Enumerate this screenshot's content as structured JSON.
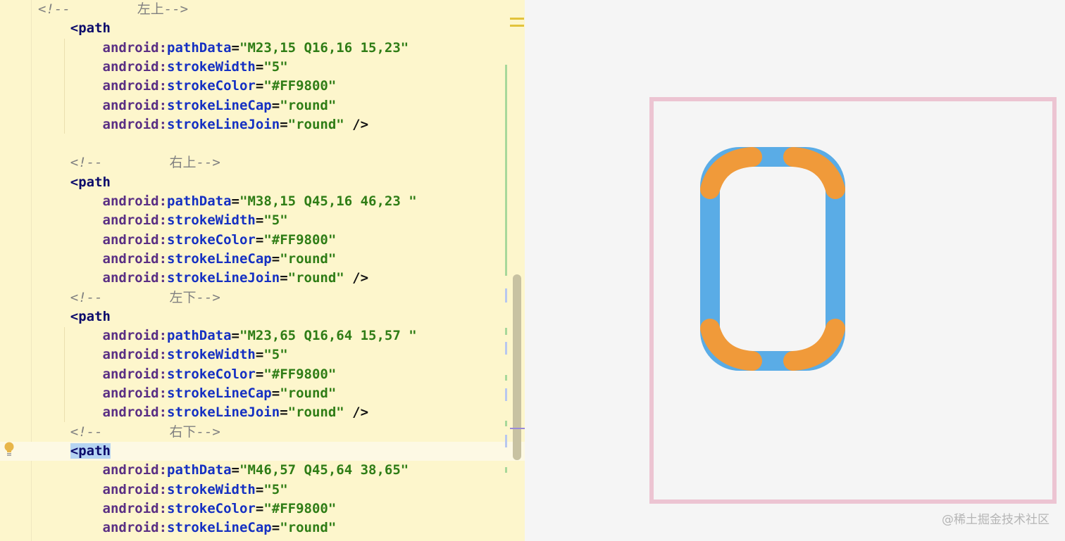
{
  "editor": {
    "lines": [
      {
        "kind": "comment",
        "indent": "",
        "open": "<!--",
        "label": "左上",
        "close": "-->"
      },
      {
        "kind": "tag",
        "indent": "    ",
        "text": "<path"
      },
      {
        "kind": "attr",
        "indent": "        ",
        "ns": "android:",
        "name": "pathData",
        "value": "\"M23,15 Q16,16 15,23\"",
        "tail": ""
      },
      {
        "kind": "attr",
        "indent": "        ",
        "ns": "android:",
        "name": "strokeWidth",
        "value": "\"5\"",
        "tail": ""
      },
      {
        "kind": "attr",
        "indent": "        ",
        "ns": "android:",
        "name": "strokeColor",
        "value": "\"#FF9800\"",
        "tail": ""
      },
      {
        "kind": "attr",
        "indent": "        ",
        "ns": "android:",
        "name": "strokeLineCap",
        "value": "\"round\"",
        "tail": ""
      },
      {
        "kind": "attr",
        "indent": "        ",
        "ns": "android:",
        "name": "strokeLineJoin",
        "value": "\"round\"",
        "tail": " />"
      },
      {
        "kind": "blank"
      },
      {
        "kind": "comment",
        "indent": "    ",
        "open": "<!--",
        "label": "右上",
        "close": "-->"
      },
      {
        "kind": "tag",
        "indent": "    ",
        "text": "<path"
      },
      {
        "kind": "attr",
        "indent": "        ",
        "ns": "android:",
        "name": "pathData",
        "value": "\"M38,15 Q45,16 46,23 \"",
        "tail": ""
      },
      {
        "kind": "attr",
        "indent": "        ",
        "ns": "android:",
        "name": "strokeWidth",
        "value": "\"5\"",
        "tail": ""
      },
      {
        "kind": "attr",
        "indent": "        ",
        "ns": "android:",
        "name": "strokeColor",
        "value": "\"#FF9800\"",
        "tail": ""
      },
      {
        "kind": "attr",
        "indent": "        ",
        "ns": "android:",
        "name": "strokeLineCap",
        "value": "\"round\"",
        "tail": ""
      },
      {
        "kind": "attr",
        "indent": "        ",
        "ns": "android:",
        "name": "strokeLineJoin",
        "value": "\"round\"",
        "tail": " />"
      },
      {
        "kind": "comment",
        "indent": "    ",
        "open": "<!--",
        "label": "左下",
        "close": "-->"
      },
      {
        "kind": "tag",
        "indent": "    ",
        "text": "<path"
      },
      {
        "kind": "attr",
        "indent": "        ",
        "ns": "android:",
        "name": "pathData",
        "value": "\"M23,65 Q16,64 15,57 \"",
        "tail": ""
      },
      {
        "kind": "attr",
        "indent": "        ",
        "ns": "android:",
        "name": "strokeWidth",
        "value": "\"5\"",
        "tail": ""
      },
      {
        "kind": "attr",
        "indent": "        ",
        "ns": "android:",
        "name": "strokeColor",
        "value": "\"#FF9800\"",
        "tail": ""
      },
      {
        "kind": "attr",
        "indent": "        ",
        "ns": "android:",
        "name": "strokeLineCap",
        "value": "\"round\"",
        "tail": ""
      },
      {
        "kind": "attr",
        "indent": "        ",
        "ns": "android:",
        "name": "strokeLineJoin",
        "value": "\"round\"",
        "tail": " />"
      },
      {
        "kind": "comment",
        "indent": "    ",
        "open": "<!--",
        "label": "右下",
        "close": "-->"
      },
      {
        "kind": "tag",
        "indent": "    ",
        "text": "<path",
        "active": true
      },
      {
        "kind": "attr",
        "indent": "        ",
        "ns": "android:",
        "name": "pathData",
        "value": "\"M46,57 Q45,64 38,65\"",
        "tail": ""
      },
      {
        "kind": "attr",
        "indent": "        ",
        "ns": "android:",
        "name": "strokeWidth",
        "value": "\"5\"",
        "tail": ""
      },
      {
        "kind": "attr",
        "indent": "        ",
        "ns": "android:",
        "name": "strokeColor",
        "value": "\"#FF9800\"",
        "tail": ""
      },
      {
        "kind": "attr",
        "indent": "        ",
        "ns": "android:",
        "name": "strokeLineCap",
        "value": "\"round\"",
        "tail": ""
      }
    ],
    "intention_icon": "lightbulb-icon"
  },
  "preview": {
    "frame_color": "#ecc4d2",
    "canvas_color": "#f5f5f5",
    "body_color": "#5aace6",
    "corner_color": "#f09a3a",
    "watermark": "@稀土掘金技术社区"
  },
  "colors": {
    "editor_bg": "#fdf6cc",
    "preview_bg": "#f5f5f5"
  }
}
